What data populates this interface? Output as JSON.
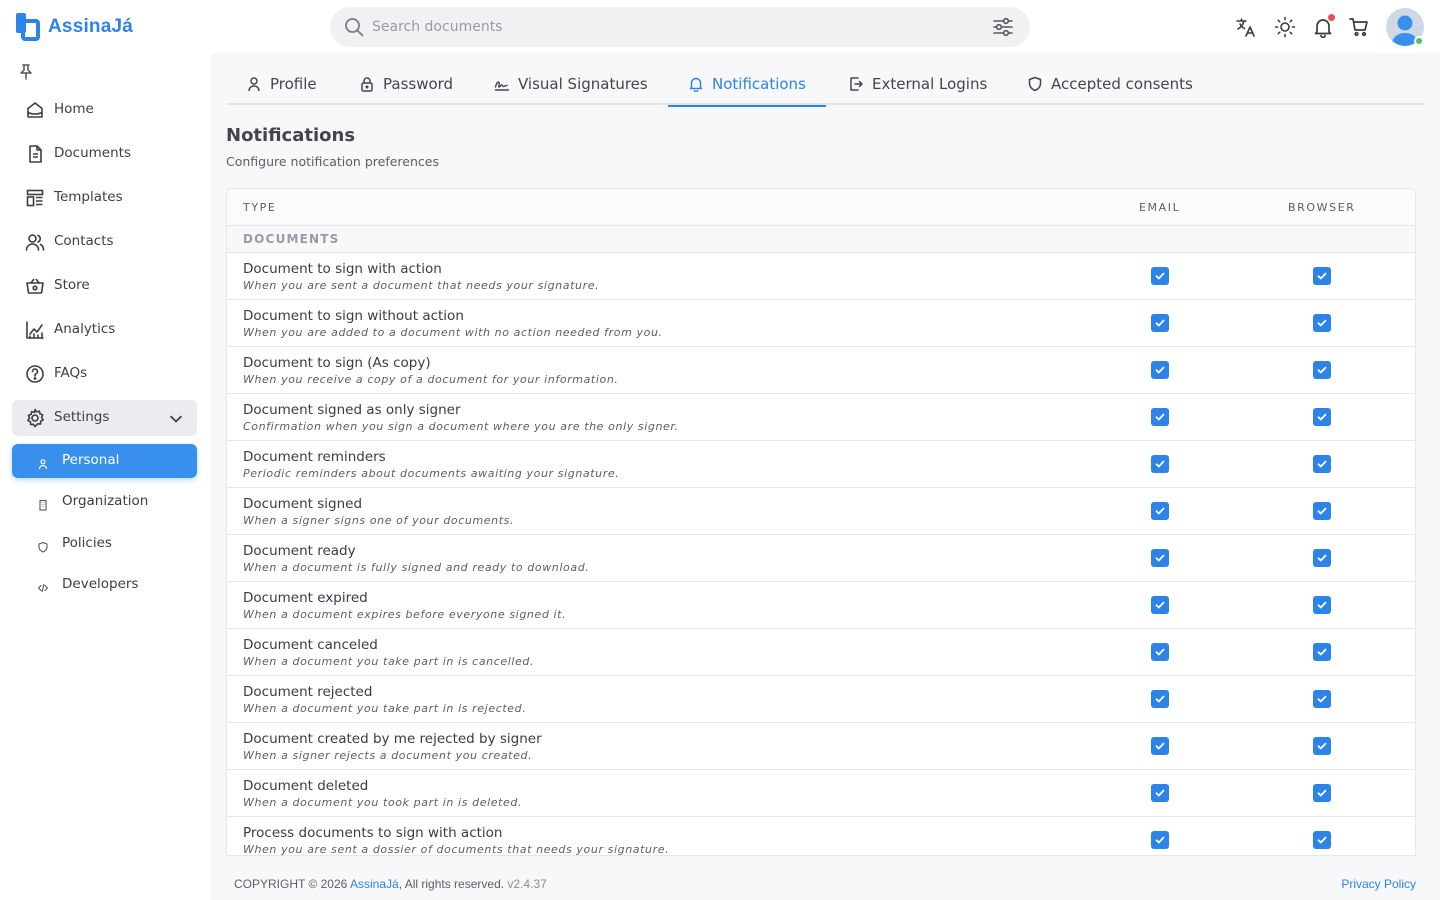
{
  "app": {
    "name": "AssinaJá",
    "brand_color": "#2c83e8"
  },
  "search": {
    "placeholder": "Search documents"
  },
  "topbar_icons": [
    "translate-icon",
    "theme-sun-icon",
    "bell-icon",
    "cart-icon",
    "user-avatar"
  ],
  "sidebar": {
    "items": [
      {
        "label": "Home",
        "icon": "home-icon"
      },
      {
        "label": "Documents",
        "icon": "document-icon"
      },
      {
        "label": "Templates",
        "icon": "template-icon"
      },
      {
        "label": "Contacts",
        "icon": "contacts-icon"
      },
      {
        "label": "Store",
        "icon": "basket-icon"
      },
      {
        "label": "Analytics",
        "icon": "chart-icon"
      },
      {
        "label": "FAQs",
        "icon": "help-icon"
      }
    ],
    "settings": {
      "label": "Settings",
      "icon": "settings-icon",
      "expanded": true
    },
    "subitems": [
      {
        "label": "Personal",
        "icon": "user-icon",
        "active": true
      },
      {
        "label": "Organization",
        "icon": "building-icon",
        "active": false
      },
      {
        "label": "Policies",
        "icon": "shield-icon",
        "active": false
      },
      {
        "label": "Developers",
        "icon": "code-icon",
        "active": false
      }
    ]
  },
  "tabs": [
    {
      "label": "Profile",
      "icon": "user-icon",
      "active": false
    },
    {
      "label": "Password",
      "icon": "lock-icon",
      "active": false
    },
    {
      "label": "Visual Signatures",
      "icon": "signature-icon",
      "active": false
    },
    {
      "label": "Notifications",
      "icon": "bell-icon",
      "active": true
    },
    {
      "label": "External Logins",
      "icon": "login-icon",
      "active": false
    },
    {
      "label": "Accepted consents",
      "icon": "shield-check-icon",
      "active": false
    }
  ],
  "section": {
    "title": "Notifications",
    "subtitle": "Configure notification preferences"
  },
  "table": {
    "columns": {
      "type": "TYPE",
      "email": "EMAIL",
      "browser": "BROWSER"
    },
    "group": "DOCUMENTS",
    "rows": [
      {
        "title": "Document to sign with action",
        "desc": "When you are sent a document that needs your signature.",
        "email": true,
        "browser": true
      },
      {
        "title": "Document to sign without action",
        "desc": "When you are added to a document with no action needed from you.",
        "email": true,
        "browser": true
      },
      {
        "title": "Document to sign (As copy)",
        "desc": "When you receive a copy of a document for your information.",
        "email": true,
        "browser": true
      },
      {
        "title": "Document signed as only signer",
        "desc": "Confirmation when you sign a document where you are the only signer.",
        "email": true,
        "browser": true
      },
      {
        "title": "Document reminders",
        "desc": "Periodic reminders about documents awaiting your signature.",
        "email": true,
        "browser": true
      },
      {
        "title": "Document signed",
        "desc": "When a signer signs one of your documents.",
        "email": true,
        "browser": true
      },
      {
        "title": "Document ready",
        "desc": "When a document is fully signed and ready to download.",
        "email": true,
        "browser": true
      },
      {
        "title": "Document expired",
        "desc": "When a document expires before everyone signed it.",
        "email": true,
        "browser": true
      },
      {
        "title": "Document canceled",
        "desc": "When a document you take part in is cancelled.",
        "email": true,
        "browser": true
      },
      {
        "title": "Document rejected",
        "desc": "When a document you take part in is rejected.",
        "email": true,
        "browser": true
      },
      {
        "title": "Document created by me rejected by signer",
        "desc": "When a signer rejects a document you created.",
        "email": true,
        "browser": true
      },
      {
        "title": "Document deleted",
        "desc": "When a document you took part in is deleted.",
        "email": true,
        "browser": true
      },
      {
        "title": "Process documents to sign with action",
        "desc": "When you are sent a dossier of documents that needs your signature.",
        "email": true,
        "browser": true
      }
    ]
  },
  "footer": {
    "copyright": "COPYRIGHT © 2026 ",
    "brand_link": "AssinaJá",
    "rights": ", All rights reserved.",
    "version": "v2.4.37",
    "privacy": "Privacy Policy"
  }
}
